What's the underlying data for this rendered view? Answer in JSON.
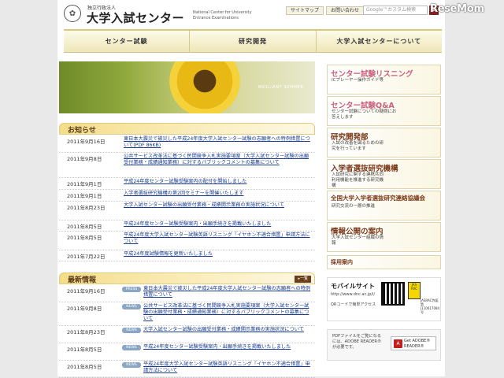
{
  "header": {
    "org_small": "独立行政法人",
    "org_name": "大学入試センター",
    "org_en": "National Center for University Entrance Examinations",
    "links": [
      "サイトマップ",
      "お問い合わせ"
    ],
    "search_placeholder": "Google™カスタム検索",
    "watermark": "ReseMom"
  },
  "nav": [
    "センター試験",
    "研究開発",
    "大学入試センターについて"
  ],
  "banner": {
    "caption": "BRILLIANT SUMMER"
  },
  "notices": {
    "title": "お知らせ",
    "items": [
      {
        "date": "2011年9月16日",
        "text": "東日本大震災で被災した平成24年度大学入試センター試験の志願者への特例措置について(PDF 86KB)"
      },
      {
        "date": "2011年9月8日",
        "text": "公共サービス改革法に基づく民間競争入札実施要項案（大学入試センター試験の出願受付業務・成績通知業務）に対するパブリックコメントの募集について"
      },
      {
        "date": "2011年9月1日",
        "text": "平成24年度センター試験受験案内の配付を開始しました"
      },
      {
        "date": "2011年9月1日",
        "text": "入学者選抜研究機構の第2回セミナーを開催いたします"
      },
      {
        "date": "2011年8月23日",
        "text": "大学入試センター試験の出願受付業務・成績開示業務の実施状況について"
      },
      {
        "date": "2011年8月5日",
        "text": "平成24年度センター試験受験案内・出願手続きを掲載いたしました"
      },
      {
        "date": "2011年8月5日",
        "text": "平成24年度大学入試センター試験英語リスニング「イヤホン不適合措置」申請方法について"
      },
      {
        "date": "2011年7月22日",
        "text": "平成24年度試験情報を更新いたしました"
      }
    ]
  },
  "latest": {
    "title": "最新情報",
    "more": "▸一覧",
    "items": [
      {
        "date": "2011年9月16日",
        "badge": "PRESS",
        "text": "東日本大震災で被災した平成24年度大学入試センター試験の志願者への特例措置について"
      },
      {
        "date": "2011年9月8日",
        "badge": "NEWS",
        "text": "公共サービス改革法に基づく民間競争入札実施要項案（大学入試センター試験の出願受付業務・成績通知業務）に対するパブリックコメントの募集について"
      },
      {
        "date": "2011年8月23日",
        "badge": "NEWS",
        "text": "大学入試センター試験の出願受付業務・成績開示業務の実施状況について"
      },
      {
        "date": "2011年8月5日",
        "badge": "NEWS",
        "text": "平成24年度センター試験受験案内・出願手続きを掲載いたしました"
      },
      {
        "date": "2011年8月5日",
        "badge": "NEWS",
        "text": "平成24年度大学入試センター試験英語リスニング「イヤホン不適合措置」申請方法について"
      }
    ]
  },
  "sidebar": [
    {
      "title": "センター試験リスニング",
      "sub": "ICプレーヤー操作ガイド等",
      "color": "#c8607e"
    },
    {
      "title": "センター試験Q&A",
      "sub": "センター試験についての疑問にお答えします",
      "color": "#c8607e"
    },
    {
      "title": "研究開発部",
      "sub": "入試の改善を図るための研究を行っています",
      "color": "#7a3a1a"
    },
    {
      "title": "入学者選抜研究機構",
      "sub": "入試研究に関する連携共同利用機能を推進する研究機構",
      "color": "#7a3a1a"
    },
    {
      "title": "全国大学入学者選抜研究連絡協議会",
      "sub": "研究交流の一層の推進",
      "color": "#7a3a1a"
    },
    {
      "title": "情報公開の案内",
      "sub": "大学入試センター組織の情報",
      "color": "#7a3a1a"
    },
    {
      "title": "採用案内",
      "sub": "",
      "color": "#7a3a1a"
    }
  ],
  "mobile": {
    "title": "モバイルサイト",
    "url": "http://www.dnc.ac.jp/i/",
    "note": "QRコードで簡単アクセス",
    "jasrac": "JASRAC許諾第J110617084号"
  },
  "pdf": {
    "text": "PDFファイルをご覧になるには、ADOBE READER®が必要です。",
    "button": "Get ADOBE® READER®"
  }
}
